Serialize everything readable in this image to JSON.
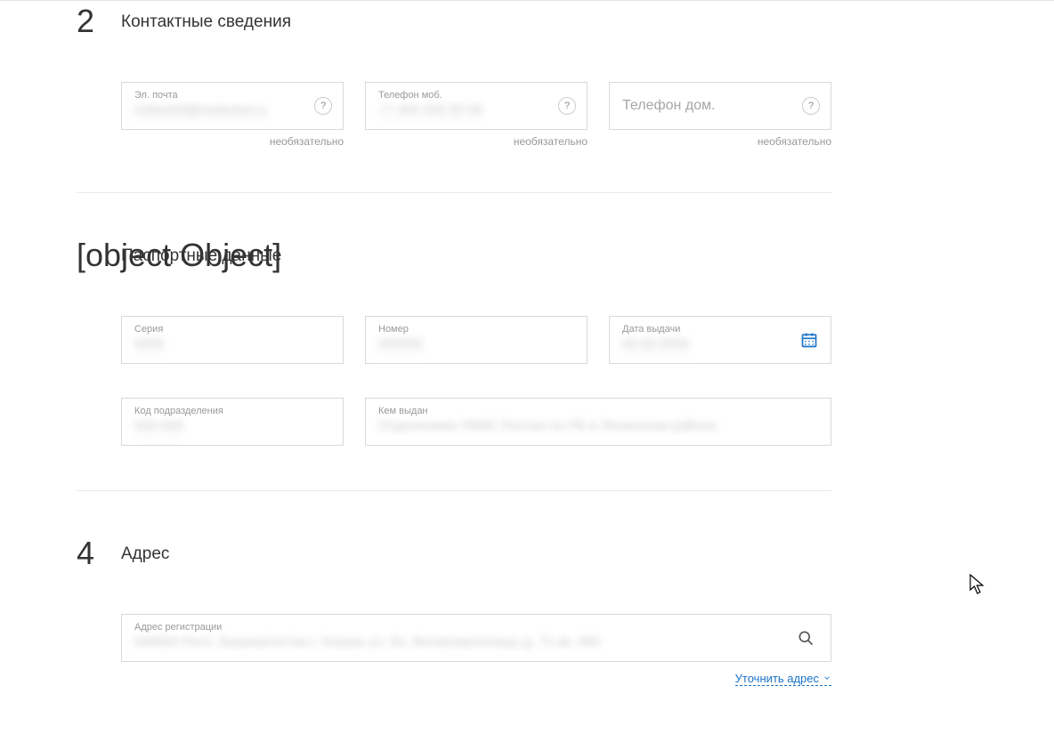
{
  "section2": {
    "number": "2",
    "title": "Контактные сведения",
    "email": {
      "label": "Эл. почта",
      "value": "redacted@redacted.ru",
      "hint": "необязательно",
      "help": "?"
    },
    "phone_mobile": {
      "label": "Телефон моб.",
      "value": "+7 000 000 00 00",
      "hint": "необязательно",
      "help": "?"
    },
    "phone_home": {
      "placeholder": "Телефон дом.",
      "hint": "необязательно",
      "help": "?"
    }
  },
  "section3": {
    "number": {
      "label": "Номер",
      "value": "000000"
    },
    "title": "Паспортные данные",
    "series": {
      "label": "Серия",
      "value": "0000"
    },
    "issue_date": {
      "label": "Дата выдачи",
      "value": "00.00.0000"
    },
    "dept_code": {
      "label": "Код подразделения",
      "value": "000-000"
    },
    "issued_by": {
      "label": "Кем выдан",
      "value": "Отделением УФМС России по РБ в Ленинском районе"
    }
  },
  "section4": {
    "number": "4",
    "title": "Адрес",
    "reg_address": {
      "label": "Адрес регистрации",
      "value": "000000 Респ. Башкортостан г. Казань ул. Ек. Великомученицы д. 71 кв. 000"
    },
    "refine_link": "Уточнить адрес"
  }
}
